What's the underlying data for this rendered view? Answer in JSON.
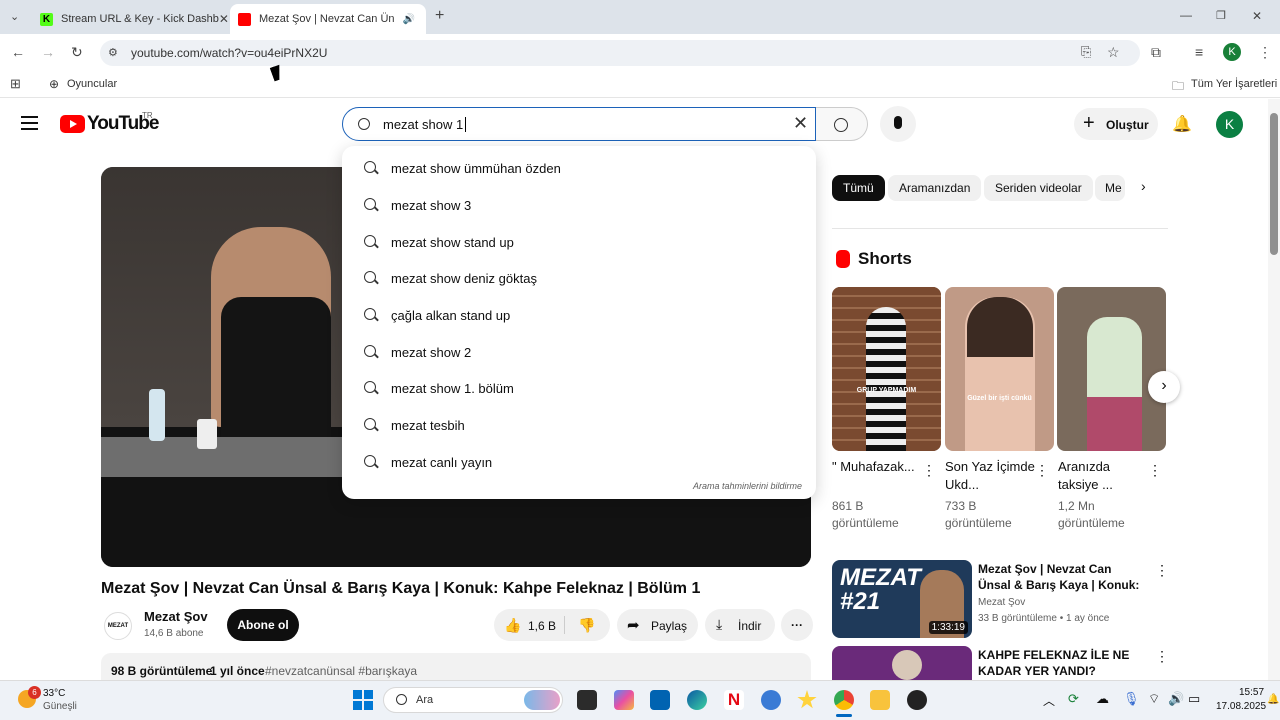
{
  "browser": {
    "tabs": [
      {
        "label": "Stream URL & Key - Kick Dashb",
        "active": false
      },
      {
        "label": "Mezat Şov | Nevzat Can Ün",
        "active": true
      }
    ],
    "url": "youtube.com/watch?v=ou4eiPrNX2U",
    "bookmark": "Oyuncular",
    "all_bookmarks": "Tüm Yer İşaretleri",
    "profile_initial": "K"
  },
  "youtube": {
    "logo_text": "YouTube",
    "logo_region": "TR",
    "search_value": "mezat show 1",
    "suggestions": [
      "mezat show ümmühan özden",
      "mezat show 3",
      "mezat show stand up",
      "mezat show deniz göktaş",
      "çağla alkan stand up",
      "mezat show 2",
      "mezat show 1. bölüm",
      "mezat tesbih",
      "mezat canlı yayın"
    ],
    "report_predictions": "Arama tahminlerini bildirme",
    "create_label": "Oluştur",
    "avatar_initial": "K",
    "video": {
      "title": "Mezat Şov | Nevzat Can Ünsal & Barış Kaya | Konuk: Kahpe Feleknaz | Bölüm 1",
      "channel": "Mezat Şov",
      "subscribers": "14,6 B abone",
      "subscribe": "Abone ol",
      "likes": "1,6 B",
      "share": "Paylaş",
      "download": "İndir",
      "views": "98 B görüntüleme",
      "age": "1 yıl önce",
      "tags": "#nevzatcanünsal #barışkaya",
      "channel_logo_text": "MEZAT"
    },
    "chips": [
      "Tümü",
      "Aramanızdan",
      "Seriden videolar",
      "Me"
    ],
    "shorts_heading": "Shorts",
    "shorts": [
      {
        "title": "\" Muhafazak...",
        "views": "861 B görüntüleme",
        "caption": "GRUP YAPMADIM",
        "color": "#8a5a3c"
      },
      {
        "title": "Son Yaz İçimde Ukd...",
        "views": "733 B görüntüleme",
        "caption": "Güzel bir işti cünkü",
        "color": "#c09a86"
      },
      {
        "title": "Aranızda taksiye ...",
        "views": "1,2 Mn görüntüleme",
        "caption": "",
        "color": "#7a6a5c"
      }
    ],
    "related": [
      {
        "title": "Mezat Şov | Nevzat Can Ünsal & Barış Kaya | Konuk: Caner Dağl...",
        "channel": "Mezat Şov",
        "meta": "33 B görüntüleme • 1 ay önce",
        "duration": "1:33:19",
        "thumb_text": "MEZAT #21"
      },
      {
        "title": "KAHPE FELEKNAZ İLE NE KADAR YER YANDI?",
        "channel": "",
        "meta": "",
        "duration": "",
        "thumb_text": ""
      }
    ]
  },
  "taskbar": {
    "weather_temp": "33°C",
    "weather_desc": "Güneşli",
    "weather_badge": "6",
    "search": "Ara",
    "time": "15:57",
    "date": "17.08.2025"
  }
}
